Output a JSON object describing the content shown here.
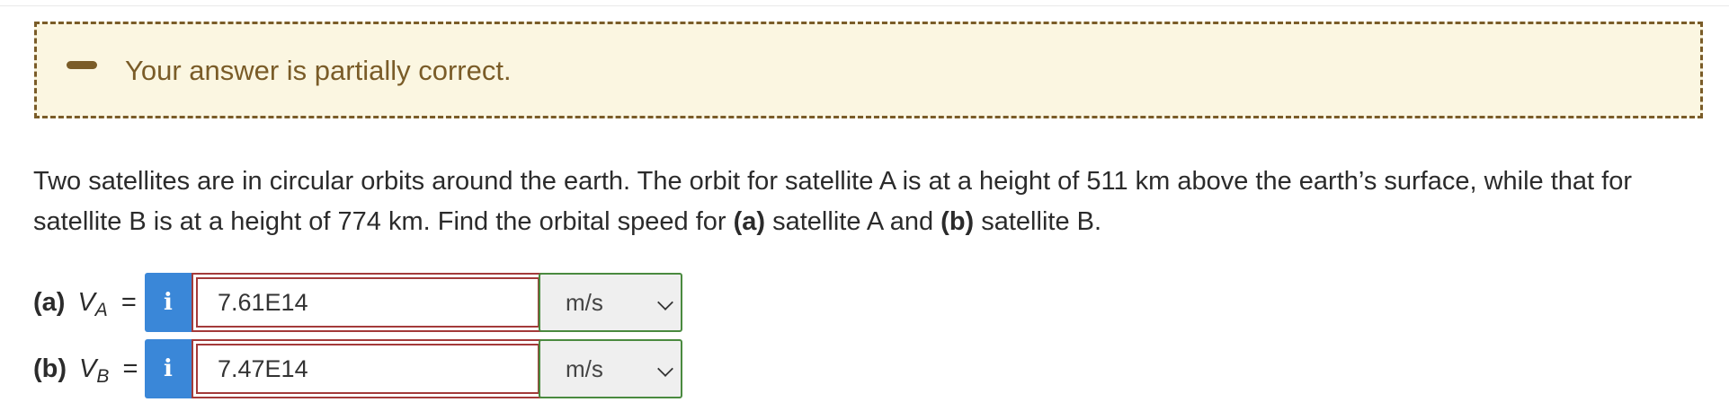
{
  "feedback": {
    "message": "Your answer is partially correct.",
    "icon": "minus-icon",
    "color": "#7a5c28",
    "background": "#fbf6e1"
  },
  "question": {
    "text_1": "Two satellites are in circular orbits around the earth. The orbit for satellite A is at a height of 511 km above the earth’s surface, while that for satellite B is at a height of 774 km. Find the orbital speed for ",
    "bold_a": "(a)",
    "text_2": " satellite A and ",
    "bold_b": "(b)",
    "text_3": " satellite B."
  },
  "answers": [
    {
      "part": "(a)",
      "var": "V",
      "sub": "A",
      "eq": "=",
      "info_icon": "i",
      "value": "7.61E14",
      "unit": "m/s"
    },
    {
      "part": "(b)",
      "var": "V",
      "sub": "B",
      "eq": "=",
      "info_icon": "i",
      "value": "7.47E14",
      "unit": "m/s"
    }
  ],
  "colors": {
    "info_button": "#3a87d8",
    "incorrect_border": "#a33a3a",
    "correct_unit_border": "#4a8a3f"
  }
}
